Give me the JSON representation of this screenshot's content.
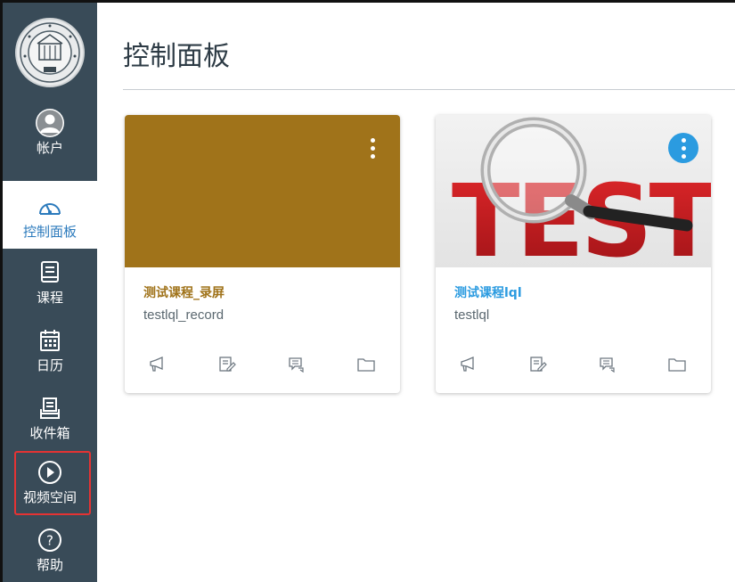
{
  "nav": {
    "logo_icon": "university-seal-logo",
    "items": [
      {
        "label": "帐户",
        "icon": "avatar-icon"
      },
      {
        "label": "控制面板",
        "icon": "dashboard-icon",
        "active": true
      },
      {
        "label": "课程",
        "icon": "courses-icon"
      },
      {
        "label": "日历",
        "icon": "calendar-icon"
      },
      {
        "label": "收件箱",
        "icon": "inbox-icon"
      },
      {
        "label": "视频空间",
        "icon": "play-circle-icon",
        "highlighted": true
      },
      {
        "label": "帮助",
        "icon": "help-icon"
      }
    ],
    "colors": {
      "background": "#394b58",
      "active_text": "#2b7abc",
      "highlight_border": "#e53333"
    }
  },
  "page": {
    "title": "控制面板"
  },
  "cards": [
    {
      "title": "测试课程_录屏",
      "code": "testlql_record",
      "color": "#a0731a",
      "hero": "solid-color",
      "actions": [
        "announcements-icon",
        "assignments-icon",
        "discussions-icon",
        "files-icon"
      ]
    },
    {
      "title": "测试课程lql",
      "code": "testlql",
      "color": "#2b9be0",
      "hero": "test-magnifier-image",
      "hero_text": "TEST",
      "actions": [
        "announcements-icon",
        "assignments-icon",
        "discussions-icon",
        "files-icon"
      ]
    }
  ]
}
